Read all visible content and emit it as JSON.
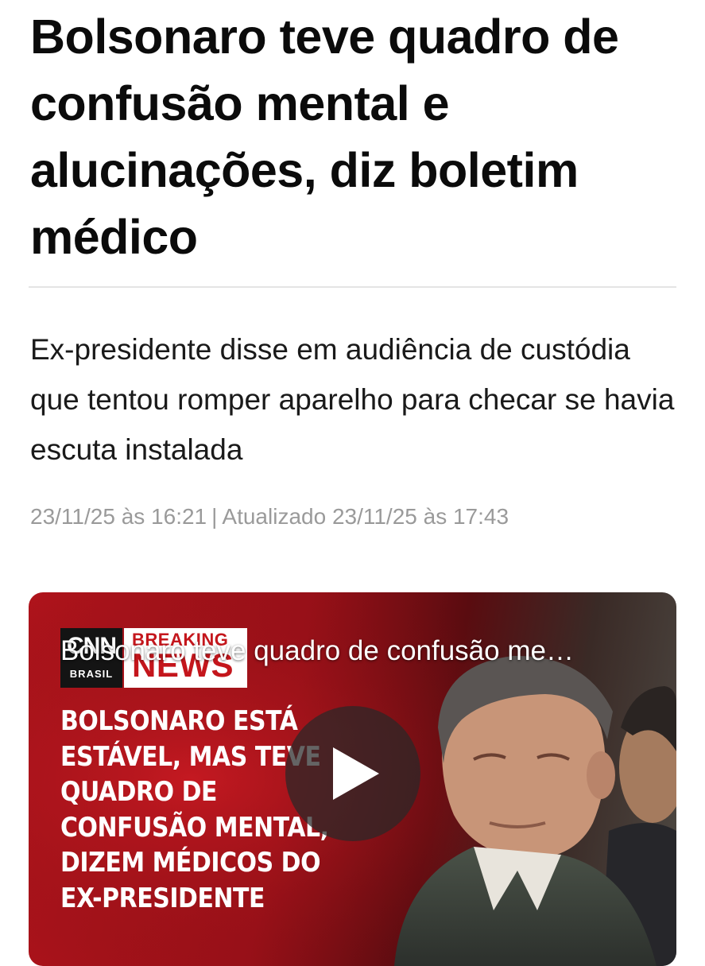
{
  "article": {
    "headline": "Bolsonaro teve quadro de confusão mental e alucinações, diz boletim médico",
    "subtitle": "Ex-presidente disse em audiência de custódia que tentou romper aparelho para checar se havia escuta instalada",
    "published": "23/11/25 às 16:21",
    "separator": "|",
    "updated": "Atualizado 23/11/25 às 17:43"
  },
  "video": {
    "title": "Bolsonaro teve quadro de confusão me…",
    "logo_text": "CNN",
    "logo_sub": "BRASIL",
    "breaking_top": "BREAKING",
    "breaking_bottom": "NEWS",
    "chyron_lines": [
      "BOLSONARO ESTÁ",
      "ESTÁVEL, MAS TEVE",
      "QUADRO DE",
      "CONFUSÃO MENTAL,",
      "DIZEM MÉDICOS DO",
      "EX-PRESIDENTE"
    ],
    "play_icon": "play-icon",
    "accent_color": "#c4161c"
  }
}
